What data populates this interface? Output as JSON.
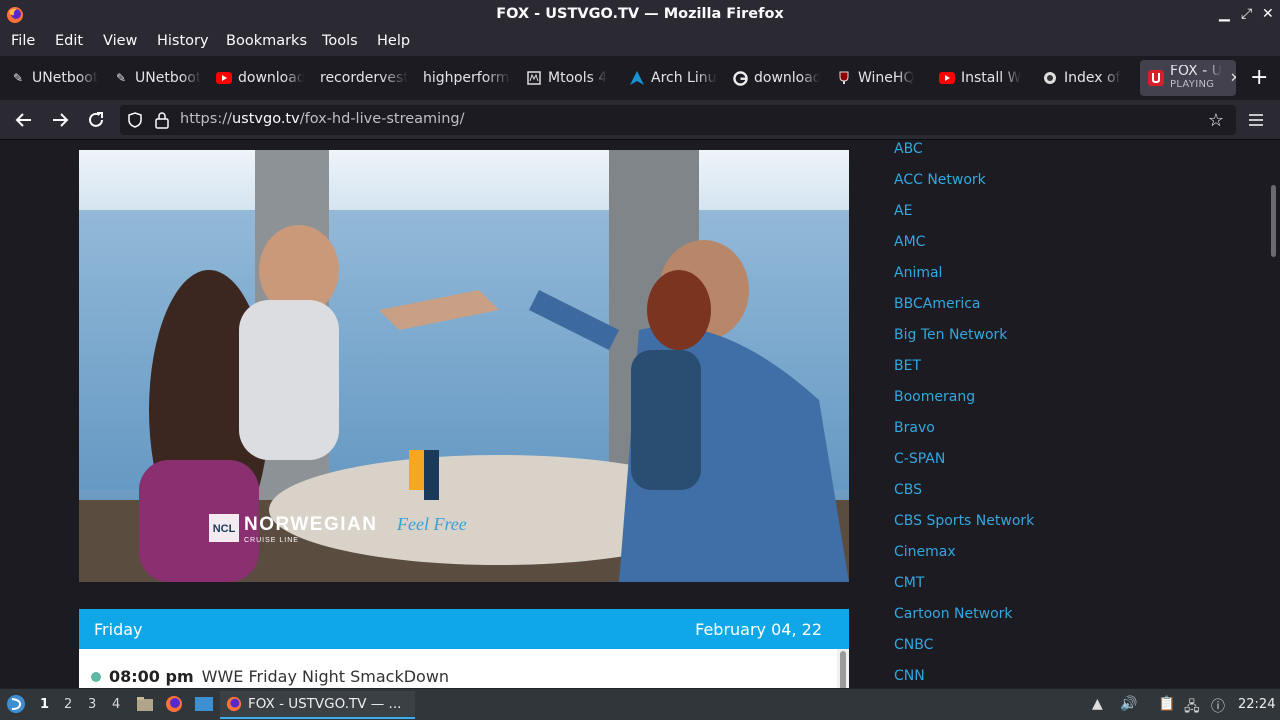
{
  "window": {
    "title": "FOX - USTVGO.TV — Mozilla Firefox"
  },
  "menu": {
    "file": "File",
    "edit": "Edit",
    "view": "View",
    "history": "History",
    "bookmarks": "Bookmarks",
    "tools": "Tools",
    "help": "Help"
  },
  "tabs": [
    {
      "label": "UNetbootin"
    },
    {
      "label": "UNetbootin"
    },
    {
      "label": "download"
    },
    {
      "label": "recorderveste"
    },
    {
      "label": "highperformance"
    },
    {
      "label": "Mtools 4"
    },
    {
      "label": "Arch Linux"
    },
    {
      "label": "download"
    },
    {
      "label": "WineHQ"
    },
    {
      "label": "Install W"
    },
    {
      "label": "Index of"
    }
  ],
  "active_tab": {
    "label": "FOX - U",
    "status": "PLAYING"
  },
  "address": {
    "prefix": "https://",
    "domain": "ustvgo.tv",
    "path": "/fox-hd-live-streaming/"
  },
  "video": {
    "brand": "NORWEGIAN",
    "brand_badge": "NCL",
    "brand_sub": "CRUISE LINE",
    "tagline": "Feel Free"
  },
  "schedule": {
    "day": "Friday",
    "date": "February 04, 22",
    "entries": [
      {
        "time": "08:00 pm",
        "show": "WWE Friday Night SmackDown"
      }
    ]
  },
  "channels": [
    "ABC",
    "ACC Network",
    "AE",
    "AMC",
    "Animal",
    "BBCAmerica",
    "Big Ten Network",
    "BET",
    "Boomerang",
    "Bravo",
    "C-SPAN",
    "CBS",
    "CBS Sports Network",
    "Cinemax",
    "CMT",
    "Cartoon Network",
    "CNBC",
    "CNN"
  ],
  "taskbar": {
    "workspaces": [
      "1",
      "2",
      "3",
      "4"
    ],
    "task_label": "FOX - USTVGO.TV — ...",
    "clock": "22:24"
  },
  "colors": {
    "accent": "#10a7e8",
    "link": "#33a7de",
    "youtube": "#ff0000",
    "task_highlight": "#3daee9"
  }
}
